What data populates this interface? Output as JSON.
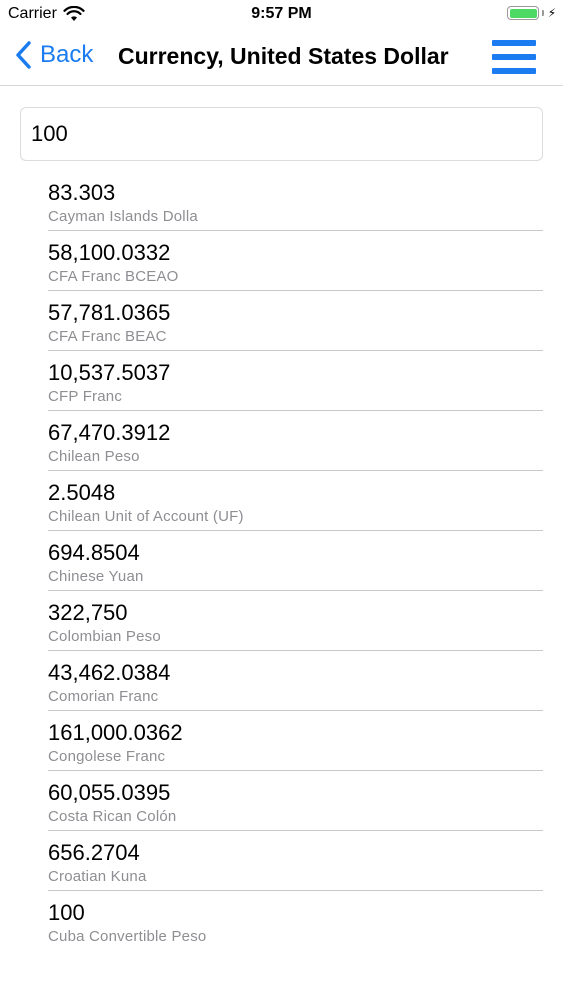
{
  "status_bar": {
    "carrier": "Carrier",
    "time": "9:57 PM",
    "battery_level": 1.0
  },
  "nav": {
    "back_label": "Back",
    "title": "Currency, United States Dollar",
    "accent_color": "#1a7cf0",
    "back_icon": "chevron-left-icon",
    "menu_icon": "hamburger-menu-icon"
  },
  "amount_input": {
    "value": "100"
  },
  "conversions": [
    {
      "value": "83.303",
      "name": "Cayman Islands Dolla"
    },
    {
      "value": "58,100.0332",
      "name": "CFA Franc BCEAO"
    },
    {
      "value": "57,781.0365",
      "name": "CFA Franc BEAC"
    },
    {
      "value": "10,537.5037",
      "name": "CFP Franc"
    },
    {
      "value": "67,470.3912",
      "name": "Chilean Peso"
    },
    {
      "value": "2.5048",
      "name": "Chilean Unit of Account (UF)"
    },
    {
      "value": "694.8504",
      "name": "Chinese Yuan"
    },
    {
      "value": "322,750",
      "name": "Colombian Peso"
    },
    {
      "value": "43,462.0384",
      "name": "Comorian Franc"
    },
    {
      "value": "161,000.0362",
      "name": "Congolese Franc"
    },
    {
      "value": "60,055.0395",
      "name": "Costa Rican Colón"
    },
    {
      "value": "656.2704",
      "name": "Croatian Kuna"
    },
    {
      "value": "100",
      "name": "Cuba Convertible Peso"
    }
  ]
}
